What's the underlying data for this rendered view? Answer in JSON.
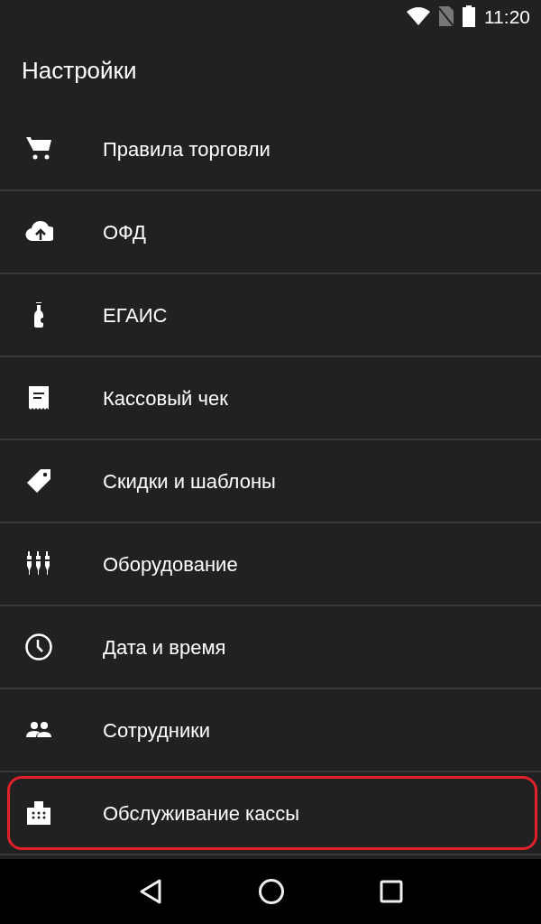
{
  "status_bar": {
    "time": "11:20"
  },
  "title": "Настройки",
  "items": [
    {
      "label": "Правила торговли",
      "highlighted": false
    },
    {
      "label": "ОФД",
      "highlighted": false
    },
    {
      "label": "ЕГАИС",
      "highlighted": false
    },
    {
      "label": "Кассовый чек",
      "highlighted": false
    },
    {
      "label": "Скидки и шаблоны",
      "highlighted": false
    },
    {
      "label": "Оборудование",
      "highlighted": false
    },
    {
      "label": "Дата и время",
      "highlighted": false
    },
    {
      "label": "Сотрудники",
      "highlighted": false
    },
    {
      "label": "Обслуживание кассы",
      "highlighted": true
    }
  ]
}
